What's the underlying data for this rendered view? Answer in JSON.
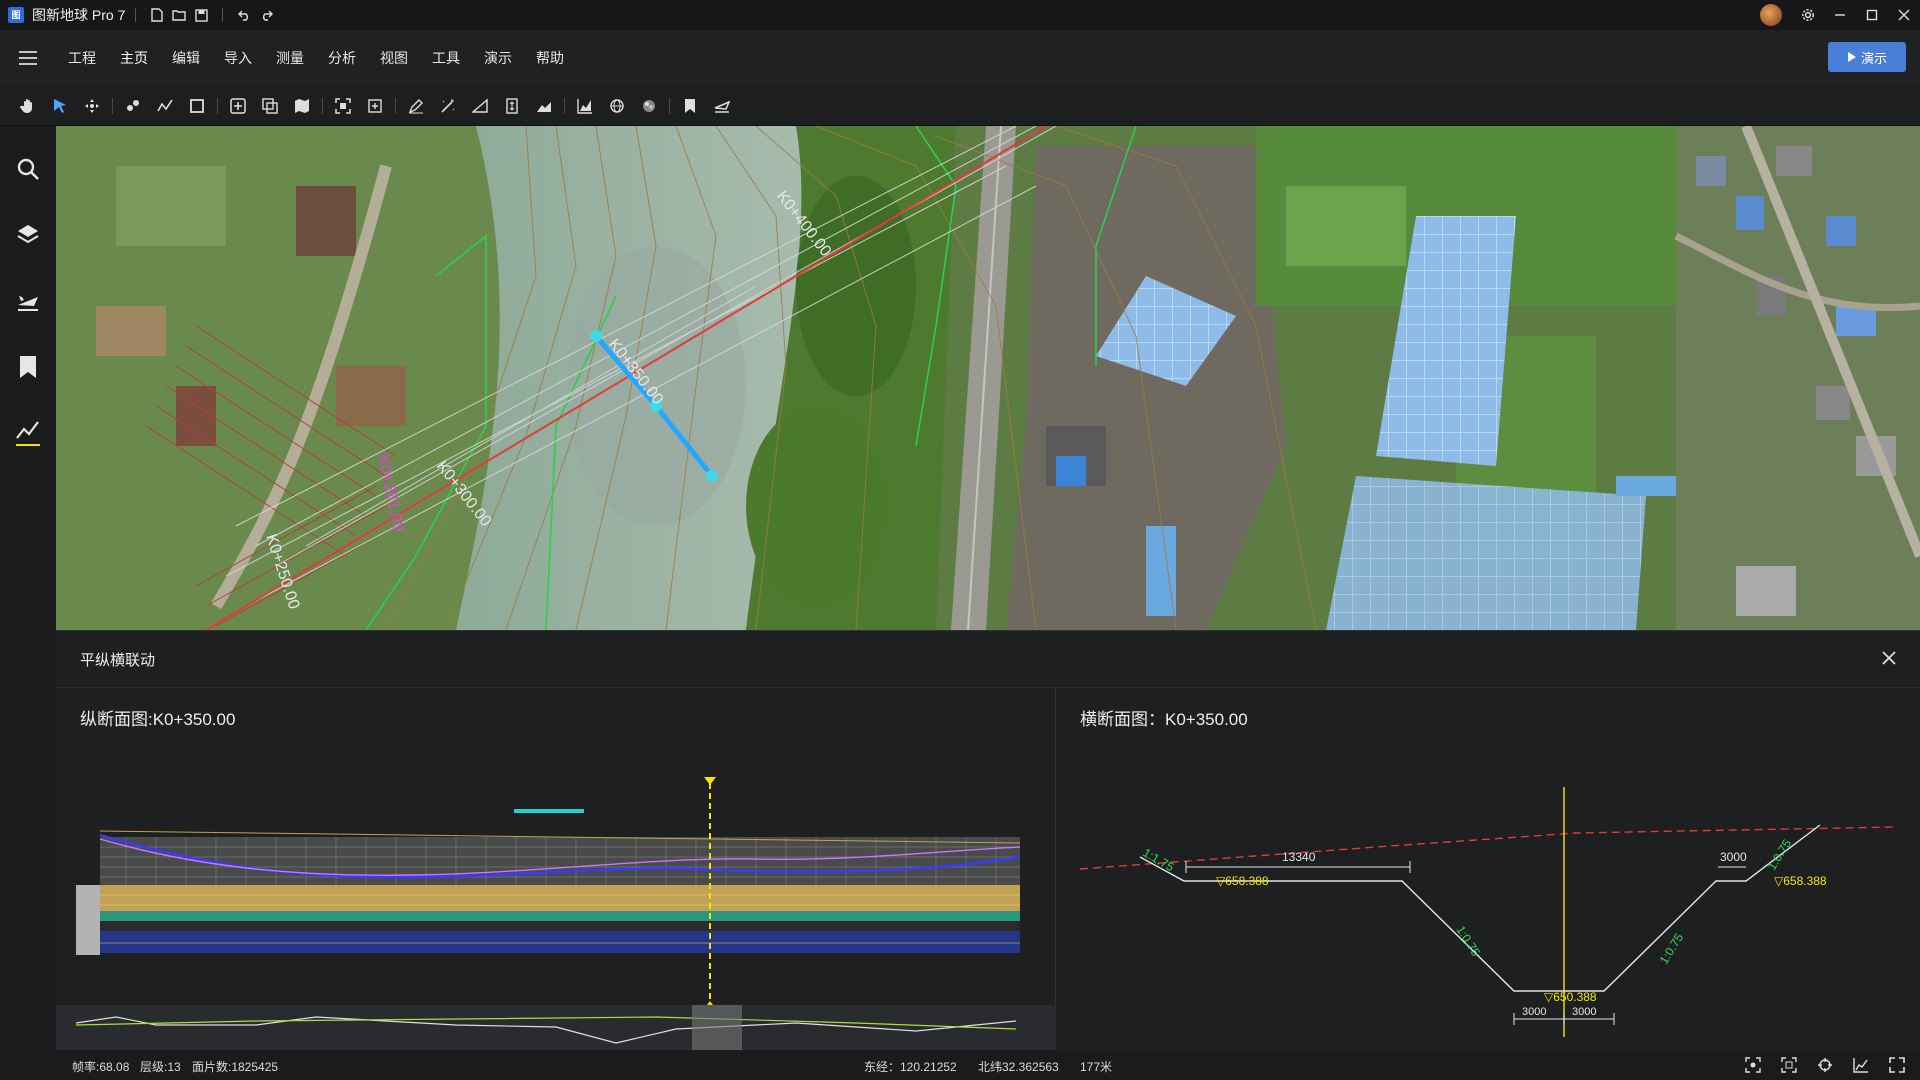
{
  "app": {
    "title": "图新地球 Pro 7",
    "logo_text": "图"
  },
  "quick_access": [
    "new-file-icon",
    "open-folder-icon",
    "save-icon",
    "undo-icon",
    "redo-icon"
  ],
  "menu": {
    "items": [
      "工程",
      "主页",
      "编辑",
      "导入",
      "测量",
      "分析",
      "视图",
      "工具",
      "演示",
      "帮助"
    ],
    "active": "主页"
  },
  "demo_button": {
    "label": "演示"
  },
  "toolbar": {
    "tools": [
      "hand-pan-icon",
      "select-arrow-icon",
      "move-icon",
      "point-icon",
      "polyline-icon",
      "rectangle-icon",
      "add-icon",
      "copy-icon",
      "map-icon",
      "fit-icon",
      "frame-icon",
      "pen-icon",
      "wand-icon",
      "slope-icon",
      "height-icon",
      "profile-icon",
      "chart-icon",
      "globe-icon",
      "color-icon",
      "bookmark-icon",
      "flight-icon"
    ]
  },
  "sidebar": {
    "items": [
      "search-icon",
      "layers-icon",
      "flight-icon",
      "bookmark-icon",
      "profile-line-icon"
    ]
  },
  "map": {
    "labels": {
      "k400": "K0+400.00",
      "k350": "K0+350.00",
      "k300": "K0+300.00",
      "k250": "K0+250.00",
      "k261": "K0+261.00"
    }
  },
  "panel": {
    "title": "平纵横联动",
    "long_profile_title": "纵断面图:K0+350.00",
    "cross_section_title": "横断面图：K0+350.00"
  },
  "cross_section": {
    "slope_left_top": "1:1.75",
    "slope_right_top": "1:0.75",
    "slope_left_mid": "1:0.75",
    "slope_right_mid": "1:0.75",
    "width_left": "13340",
    "width_right": "3000",
    "elev_left": "▽658.388",
    "elev_right": "▽658.388",
    "elev_bottom": "▽650.388",
    "bottom_left": "3000",
    "bottom_right": "3000"
  },
  "status": {
    "fps": "帧率:68.08",
    "level": "层级:13",
    "faces": "面片数:1825425",
    "east": "东经：120.21252",
    "north": "北纬32.362563",
    "dist": "177米"
  },
  "colors": {
    "accent": "#4a7fd8",
    "axis_red": "#e23b3b",
    "profile_yellow": "#f5e600",
    "text_green": "#33dd55"
  }
}
